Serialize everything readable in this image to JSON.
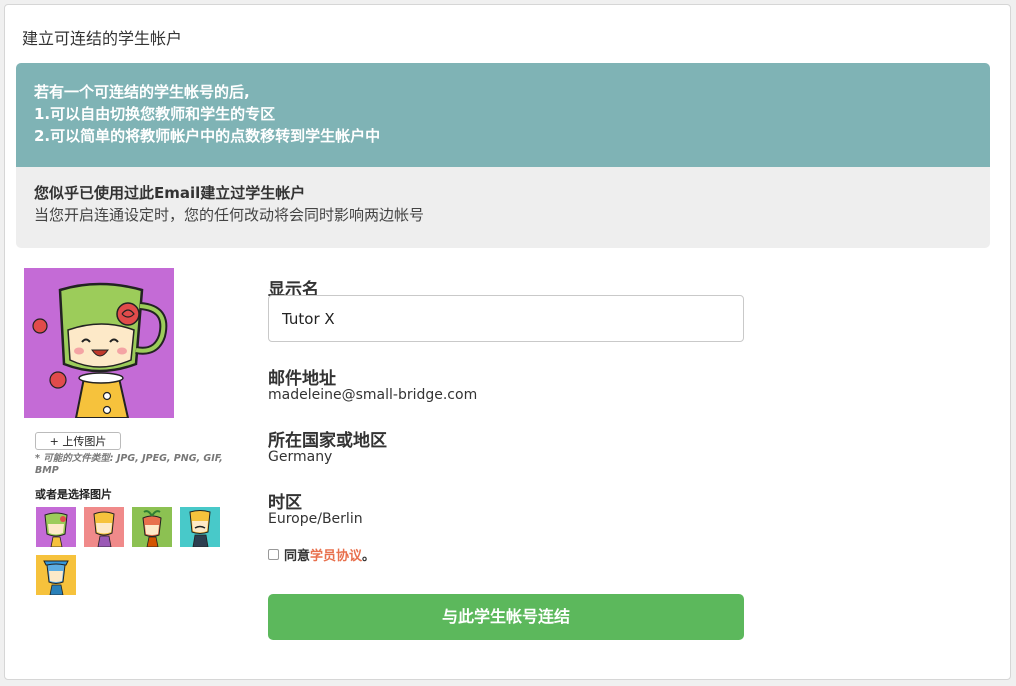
{
  "panel": {
    "title": "建立可连结的学生帐户"
  },
  "info": {
    "line1": "若有一个可连结的学生帐号的后,",
    "line2": "1.可以自由切换您教师和学生的专区",
    "line3": "2.可以简单的将教师帐户中的点数移转到学生帐户中",
    "notice_title": "您似乎已使用过此Email建立过学生帐户",
    "notice_sub": "当您开启连通设定时，您的任何改动将会同时影响两边帐号"
  },
  "avatar": {
    "upload_label": "+ 上传图片",
    "file_types": "* 可能的文件类型: JPG, JPEG, PNG, GIF, BMP",
    "choose_label": "或者是选择图片"
  },
  "form": {
    "display_name_label": "显示名",
    "display_name_value": "Tutor X",
    "email_label": "邮件地址",
    "email_value": "madeleine@small-bridge.com",
    "country_label": "所在国家或地区",
    "country_value": "Germany",
    "timezone_label": "时区",
    "timezone_value": "Europe/Berlin",
    "agree_prefix": "同意",
    "agree_link": "学员协议",
    "agree_suffix": "。",
    "connect_button": "与此学生帐号连结"
  },
  "colors": {
    "info_header_bg": "#7fb3b5",
    "button_green": "#5cb85c",
    "link_orange": "#e8704d"
  }
}
